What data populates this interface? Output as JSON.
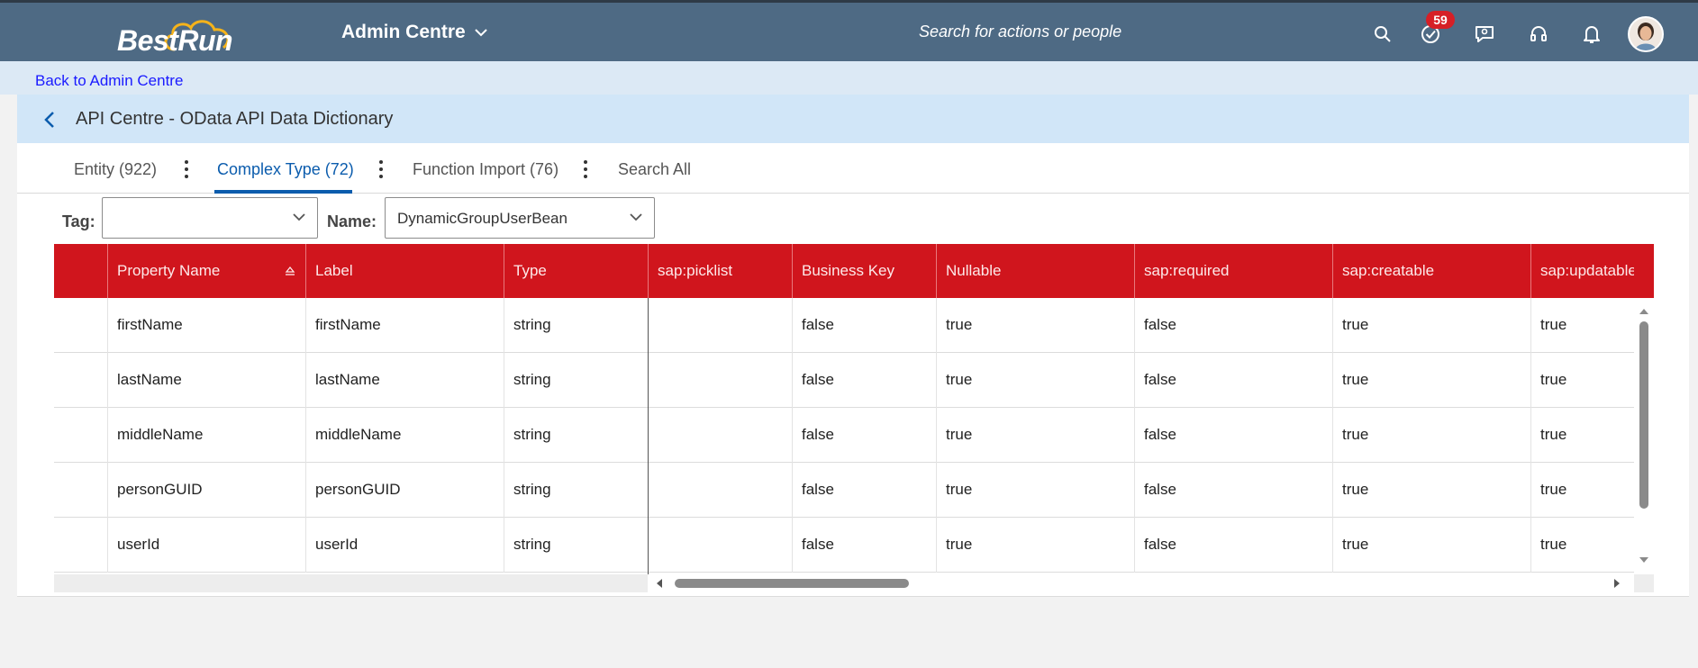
{
  "shell": {
    "logo_text": "BestRun",
    "menu_label": "Admin Centre",
    "search_placeholder": "Search for actions or people",
    "notifications_badge": "59",
    "icons": [
      "search-icon",
      "todo-check-icon",
      "feedback-icon",
      "support-headset-icon",
      "bell-icon",
      "user-avatar"
    ]
  },
  "back_link": "Back to Admin Centre",
  "page_title": "API Centre - OData API Data Dictionary",
  "tabs": [
    {
      "label": "Entity (922)",
      "active": false
    },
    {
      "label": "Complex Type (72)",
      "active": true
    },
    {
      "label": "Function Import (76)",
      "active": false
    },
    {
      "label": "Search All",
      "active": false
    }
  ],
  "filters": {
    "tag_label": "Tag:",
    "tag_value": "",
    "name_label": "Name:",
    "name_value": "DynamicGroupUserBean"
  },
  "table": {
    "columns": [
      "Property Name",
      "Label",
      "Type",
      "sap:picklist",
      "Business Key",
      "Nullable",
      "sap:required",
      "sap:creatable",
      "sap:updatable"
    ],
    "rows": [
      [
        "firstName",
        "firstName",
        "string",
        "",
        "false",
        "true",
        "false",
        "true",
        "true"
      ],
      [
        "lastName",
        "lastName",
        "string",
        "",
        "false",
        "true",
        "false",
        "true",
        "true"
      ],
      [
        "middleName",
        "middleName",
        "string",
        "",
        "false",
        "true",
        "false",
        "true",
        "true"
      ],
      [
        "personGUID",
        "personGUID",
        "string",
        "",
        "false",
        "true",
        "false",
        "true",
        "true"
      ],
      [
        "userId",
        "userId",
        "string",
        "",
        "false",
        "true",
        "false",
        "true",
        "true"
      ]
    ]
  },
  "colors": {
    "shell": "#4e6a84",
    "header": "#d1e6f8",
    "table_header": "#d0151d",
    "active_tab": "#0b5cad",
    "badge": "#d61f26"
  }
}
